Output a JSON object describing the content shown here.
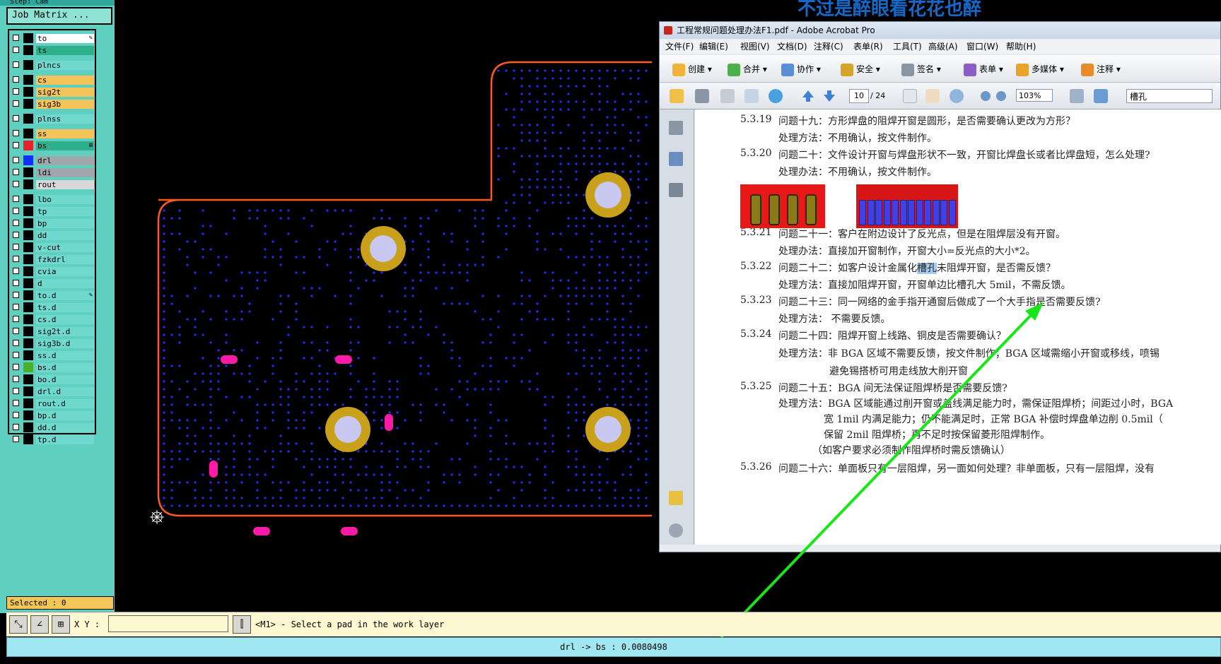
{
  "cam": {
    "step_text": "Step: Cam",
    "job_matrix_label": "Job Matrix ...",
    "layers": [
      {
        "name": "to",
        "bg": "#ffffff",
        "swatch": "#000000",
        "marker": "✎"
      },
      {
        "name": "ts",
        "bg": "#2fb08c",
        "swatch": "#000000",
        "marker": ""
      },
      {
        "name": "plncs",
        "bg": "#6fd8cf",
        "swatch": "#000000",
        "marker": ""
      },
      {
        "name": "cs",
        "bg": "#f4c45a",
        "swatch": "#000000",
        "marker": ""
      },
      {
        "name": "sig2t",
        "bg": "#f4c45a",
        "swatch": "#000000",
        "marker": ""
      },
      {
        "name": "sig3b",
        "bg": "#f4c45a",
        "swatch": "#000000",
        "marker": ""
      },
      {
        "name": "plnss",
        "bg": "#6fd8cf",
        "swatch": "#000000",
        "marker": ""
      },
      {
        "name": "ss",
        "bg": "#f4c45a",
        "swatch": "#000000",
        "marker": ""
      },
      {
        "name": "bs",
        "bg": "#2fb08c",
        "swatch": "#e8202a",
        "marker": "⊞"
      },
      {
        "name": "drl",
        "bg": "#a0a8ac",
        "swatch": "#1030ff",
        "marker": ""
      },
      {
        "name": "ldi",
        "bg": "#a0a8ac",
        "swatch": "#000000",
        "marker": ""
      },
      {
        "name": "rout",
        "bg": "#d8d8d8",
        "swatch": "#000000",
        "marker": ""
      },
      {
        "name": "lbo",
        "bg": "#6fd8cf",
        "swatch": "#000000",
        "marker": ""
      },
      {
        "name": "tp",
        "bg": "#6fd8cf",
        "swatch": "#000000",
        "marker": ""
      },
      {
        "name": "bp",
        "bg": "#6fd8cf",
        "swatch": "#000000",
        "marker": ""
      },
      {
        "name": "dd",
        "bg": "#6fd8cf",
        "swatch": "#000000",
        "marker": ""
      },
      {
        "name": "v-cut",
        "bg": "#6fd8cf",
        "swatch": "#000000",
        "marker": ""
      },
      {
        "name": "fzkdrl",
        "bg": "#6fd8cf",
        "swatch": "#000000",
        "marker": ""
      },
      {
        "name": "cvia",
        "bg": "#6fd8cf",
        "swatch": "#000000",
        "marker": ""
      },
      {
        "name": "d",
        "bg": "#6fd8cf",
        "swatch": "#000000",
        "marker": ""
      },
      {
        "name": "to.d",
        "bg": "#6fd8cf",
        "swatch": "#000000",
        "marker": "✎"
      },
      {
        "name": "ts.d",
        "bg": "#6fd8cf",
        "swatch": "#000000",
        "marker": ""
      },
      {
        "name": "cs.d",
        "bg": "#6fd8cf",
        "swatch": "#000000",
        "marker": ""
      },
      {
        "name": "sig2t.d",
        "bg": "#6fd8cf",
        "swatch": "#000000",
        "marker": ""
      },
      {
        "name": "sig3b.d",
        "bg": "#6fd8cf",
        "swatch": "#000000",
        "marker": ""
      },
      {
        "name": "ss.d",
        "bg": "#6fd8cf",
        "swatch": "#000000",
        "marker": ""
      },
      {
        "name": "bs.d",
        "bg": "#6fd8cf",
        "swatch": "#4caf2a",
        "marker": ""
      },
      {
        "name": "bo.d",
        "bg": "#6fd8cf",
        "swatch": "#000000",
        "marker": ""
      },
      {
        "name": "drl.d",
        "bg": "#6fd8cf",
        "swatch": "#000000",
        "marker": ""
      },
      {
        "name": "rout.d",
        "bg": "#6fd8cf",
        "swatch": "#000000",
        "marker": ""
      },
      {
        "name": "bp.d",
        "bg": "#6fd8cf",
        "swatch": "#000000",
        "marker": ""
      },
      {
        "name": "dd.d",
        "bg": "#6fd8cf",
        "swatch": "#000000",
        "marker": ""
      },
      {
        "name": "tp.d",
        "bg": "#6fd8cf",
        "swatch": "#000000",
        "marker": ""
      }
    ],
    "selected_text": "Selected : 0",
    "xy_label": "X Y :",
    "xy_value": "",
    "command_message": "<M1> - Select a pad in the work layer",
    "status_text": "drl -> bs : 0.0080498",
    "colors": {
      "outline": "#ff5a1e",
      "vias": "#2030ff",
      "pad_ring": "#c9a01a",
      "pad_center": "#c8c8f0",
      "slot": "#ff1aa8"
    }
  },
  "overlay_title": "不过是醉眼看花花也醉",
  "acrobat": {
    "title": "工程常规问题处理办法F1.pdf - Adobe Acrobat Pro",
    "menu": [
      "文件(F)",
      "编辑(E)",
      "视图(V)",
      "文档(D)",
      "注释(C)",
      "表单(R)",
      "工具(T)",
      "高级(A)",
      "窗口(W)",
      "帮助(H)"
    ],
    "toolbar1": [
      "创建",
      "合并",
      "协作",
      "安全",
      "签名",
      "表单",
      "多媒体",
      "注释"
    ],
    "page_current": "10",
    "page_total": "/ 24",
    "zoom": "103%",
    "search_text": "槽孔",
    "doc_lines": [
      {
        "num": "5.3.19",
        "text": "问题十九：方形焊盘的阻焊开窗是圆形，是否需要确认更改为方形？"
      },
      {
        "num": "",
        "text": "处理方法：不用确认，按文件制作。"
      },
      {
        "num": "5.3.20",
        "text": "问题二十：文件设计开窗与焊盘形状不一致，开窗比焊盘长或者比焊盘短，怎么处理?"
      },
      {
        "num": "",
        "text": "处理办法：不用确认，按文件制作。"
      },
      {
        "num": "5.3.21",
        "text": "问题二十一：客户在附边设计了反光点，但是在阻焊层没有开窗。"
      },
      {
        "num": "",
        "text": "处理办法：直接加开窗制作，开窗大小=反光点的大小*2。"
      },
      {
        "num": "5.3.22",
        "text_pre": "问题二十二：如客户设计金属化",
        "text_hl": "槽孔",
        "text_post": "未阻焊开窗，是否需反馈？"
      },
      {
        "num": "",
        "text": "处理方法：直接加阻焊开窗，开窗单边比槽孔大 5mil，不需反馈。"
      },
      {
        "num": "5.3.23",
        "text": "问题二十三：同一网络的金手指开通窗后做成了一个大手指是否需要反馈?"
      },
      {
        "num": "",
        "text": "处理方法：  不需要反馈。"
      },
      {
        "num": "5.3.24",
        "text": "问题二十四：阻焊开窗上线路、铜皮是否需要确认？"
      },
      {
        "num": "",
        "text": "处理方法：非 BGA 区域不需要反馈，按文件制作；BGA 区域需缩小开窗或移线，喷锡"
      },
      {
        "num": "",
        "text": "避免锡搭桥可用走线放大削开窗"
      },
      {
        "num": "5.3.25",
        "text": "问题二十五：BGA 间无法保证阻焊桥是否需要反馈?"
      },
      {
        "num": "",
        "text": "处理方法：BGA 区域能通过削开窗或盖线满足能力时，需保证阻焊桥；间距过小时，BGA"
      },
      {
        "num": "",
        "text": "宽 1mil 内满足能力；仍不能满足时，正常 BGA 补偿时焊盘单边削 0.5mil（"
      },
      {
        "num": "",
        "text": "保留 2mil 阻焊桥；再不足时按保留菱形阻焊制作。"
      },
      {
        "num": "",
        "text": "（如客户要求必须制作阻焊桥时需反馈确认）"
      },
      {
        "num": "5.3.26",
        "text": "问题二十六：单面板只有一层阻焊，另一面如何处理？非单面板，只有一层阻焊，没有"
      }
    ]
  }
}
